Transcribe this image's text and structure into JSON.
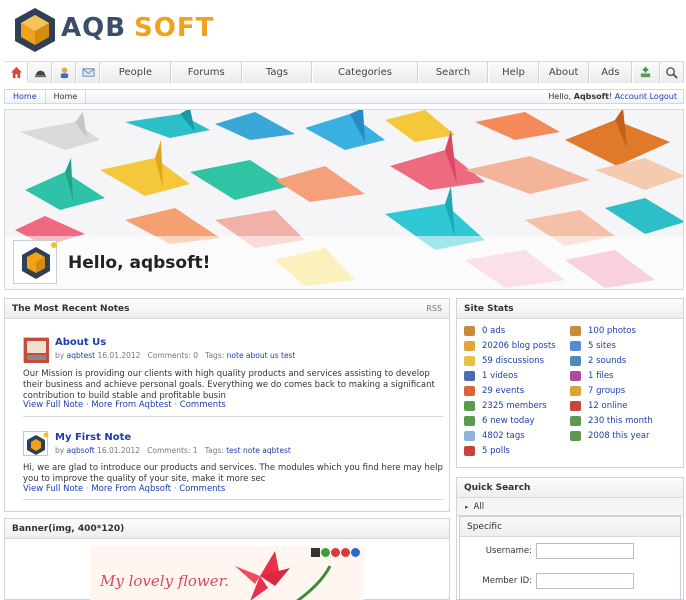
{
  "header": {
    "logo_aqb": "AQB",
    "logo_soft": "SOFT"
  },
  "nav": {
    "icons": [
      "home-icon",
      "helmet-icon",
      "user-icon",
      "mail-icon"
    ],
    "items": [
      "People",
      "Forums",
      "Tags",
      "Categories",
      "Search",
      "Help",
      "About",
      "Ads"
    ],
    "right_icons": [
      "add-icon",
      "search-icon"
    ]
  },
  "breadcrumb": {
    "items": [
      "Home",
      "Home"
    ],
    "greeting_prefix": "Hello,",
    "username": "Aqbsoft",
    "greeting_suffix": "!",
    "account_link": "Account",
    "logout_link": "Logout"
  },
  "banner": {
    "hello": "Hello, aqbsoft!"
  },
  "notes": {
    "title": "The Most Recent Notes",
    "rss": "RSS",
    "items": [
      {
        "title": "About Us",
        "by": "by",
        "author": "aqbtest",
        "date": "16.01.2012",
        "comments": "Comments: 0",
        "tags_label": "Tags:",
        "tags": "note about us test",
        "body": "Our Mission is providing our clients with high quality products and services assisting to develop their business and achieve personal goals. Everything we do comes back to making a significant contribution to build stable and profitable busin",
        "view_full": "View Full Note",
        "more_from": "More From Aqbtest",
        "comments_link": "Comments"
      },
      {
        "title": "My First Note",
        "by": "by",
        "author": "aqbsoft",
        "date": "16.01.2012",
        "comments": "Comments: 1",
        "tags_label": "Tags:",
        "tags": "test note aqbtest",
        "body": "Hi, we are glad to introduce our products and services.   The modules which you find here may help you to improve the quality of your site, make it more sec",
        "view_full": "View Full Note",
        "more_from": "More From Aqbsoft",
        "comments_link": "Comments"
      }
    ]
  },
  "banner_box": {
    "title": "Banner(img, 400*120)",
    "image_text": "My lovely flower."
  },
  "site_stats": {
    "title": "Site Stats",
    "left": [
      "0 ads",
      "20206 blog posts",
      "59 discussions",
      "1 videos",
      "29 events",
      "2325 members",
      "6 new today",
      "4802 tags",
      "5 polls"
    ],
    "right": [
      "100 photos",
      "5 sites",
      "2 sounds",
      "1 files",
      "7 groups",
      "12 online",
      "230 this month",
      "2008 this year"
    ],
    "left_colors": [
      "#c98a3a",
      "#e2a53b",
      "#e8c046",
      "#4a6bb5",
      "#d9633a",
      "#5a9a4a",
      "#5a9a4a",
      "#8fb4d9",
      "#c9443a"
    ],
    "right_colors": [
      "#c98a3a",
      "#5a8ad0",
      "#4a8ab5",
      "#b04aa0",
      "#d9a53b",
      "#c9443a",
      "#5a9a4a",
      "#5a9a4a"
    ]
  },
  "quick_search": {
    "title": "Quick Search",
    "all": "All",
    "specific": "Specific",
    "username_label": "Username:",
    "member_id_label": "Member ID:"
  }
}
